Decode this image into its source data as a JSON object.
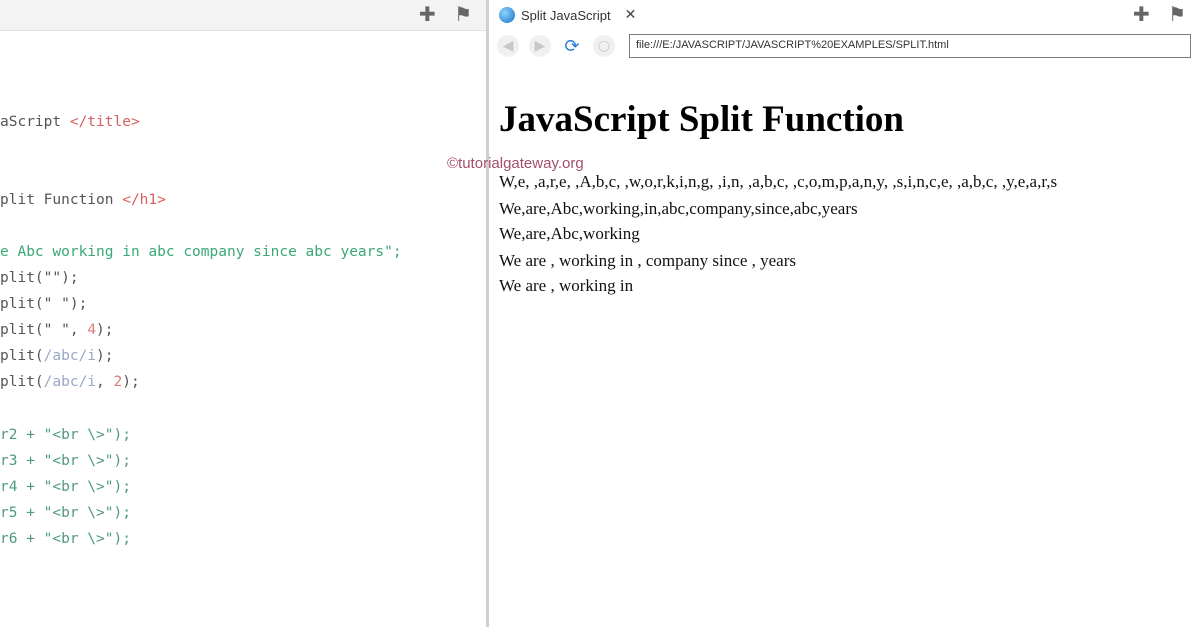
{
  "editor": {
    "toolbar_icons": "✚ ⚑",
    "lines": {
      "title_text": "aScript ",
      "title_close": "</title>",
      "h1_text": "plit Function ",
      "h1_close": "</h1>",
      "str_decl": "e Abc working in abc company since abc years\";",
      "s2_call": "plit(\"\");",
      "s3_call": "plit(\" \");",
      "s4_pre": "plit(\" \", ",
      "s4_num": "4",
      "s4_post": ");",
      "s5_pre": "plit(",
      "s5_rgx": "/abc/i",
      "s5_post": ");",
      "s6_pre": "plit(",
      "s6_rgx": "/abc/i",
      "s6_mid": ", ",
      "s6_num": "2",
      "s6_post": ");",
      "w2": "r2 + \"<br \\>\");",
      "w3": "r3 + \"<br \\>\");",
      "w4": "r4 + \"<br \\>\");",
      "w5": "r5 + \"<br \\>\");",
      "w6": "r6 + \"<br \\>\");"
    }
  },
  "browser": {
    "tab_title": "Split JavaScript",
    "tab_close": "✕",
    "toolbar_icons": "✚ ⚑",
    "address": "file:///E:/JAVASCRIPT/JAVASCRIPT%20EXAMPLES/SPLIT.html",
    "page": {
      "heading": "JavaScript Split Function",
      "outputs": [
        "W,e, ,a,r,e, ,A,b,c, ,w,o,r,k,i,n,g, ,i,n, ,a,b,c, ,c,o,m,p,a,n,y, ,s,i,n,c,e, ,a,b,c, ,y,e,a,r,s",
        "We,are,Abc,working,in,abc,company,since,abc,years",
        "We,are,Abc,working",
        "We are , working in , company since , years",
        "We are , working in"
      ]
    }
  },
  "watermark": "©tutorialgateway.org"
}
